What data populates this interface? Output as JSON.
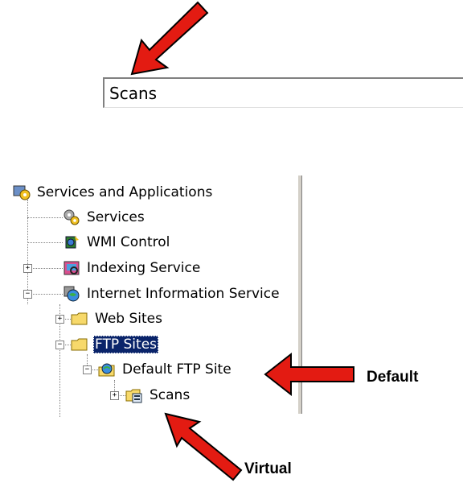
{
  "name_field": {
    "value": "Scans"
  },
  "tree": {
    "root": {
      "label": "Services and Applications",
      "icon": "services-applications-icon"
    },
    "services": {
      "label": "Services",
      "icon": "gears-icon"
    },
    "wmi": {
      "label": "WMI Control",
      "icon": "wmi-control-icon"
    },
    "indexing": {
      "label": "Indexing Service",
      "icon": "indexing-icon",
      "expander": "+"
    },
    "iis": {
      "label": "Internet Information Service",
      "icon": "iis-globe-icon",
      "expander": "−"
    },
    "web_sites": {
      "label": "Web Sites",
      "icon": "folder-icon",
      "expander": "+"
    },
    "ftp_sites": {
      "label": "FTP Sites",
      "icon": "folder-icon",
      "expander": "−",
      "selected": true
    },
    "default_ftp": {
      "label": "Default FTP Site",
      "icon": "ftp-site-icon",
      "expander": "−"
    },
    "scans": {
      "label": "Scans",
      "icon": "virtual-directory-icon",
      "expander": "+"
    }
  },
  "callouts": {
    "default": "Default",
    "virtual": "Virtual"
  },
  "colors": {
    "arrow_fill": "#e31b12",
    "selection": "#0a246a",
    "folder": "#f7d96b"
  }
}
